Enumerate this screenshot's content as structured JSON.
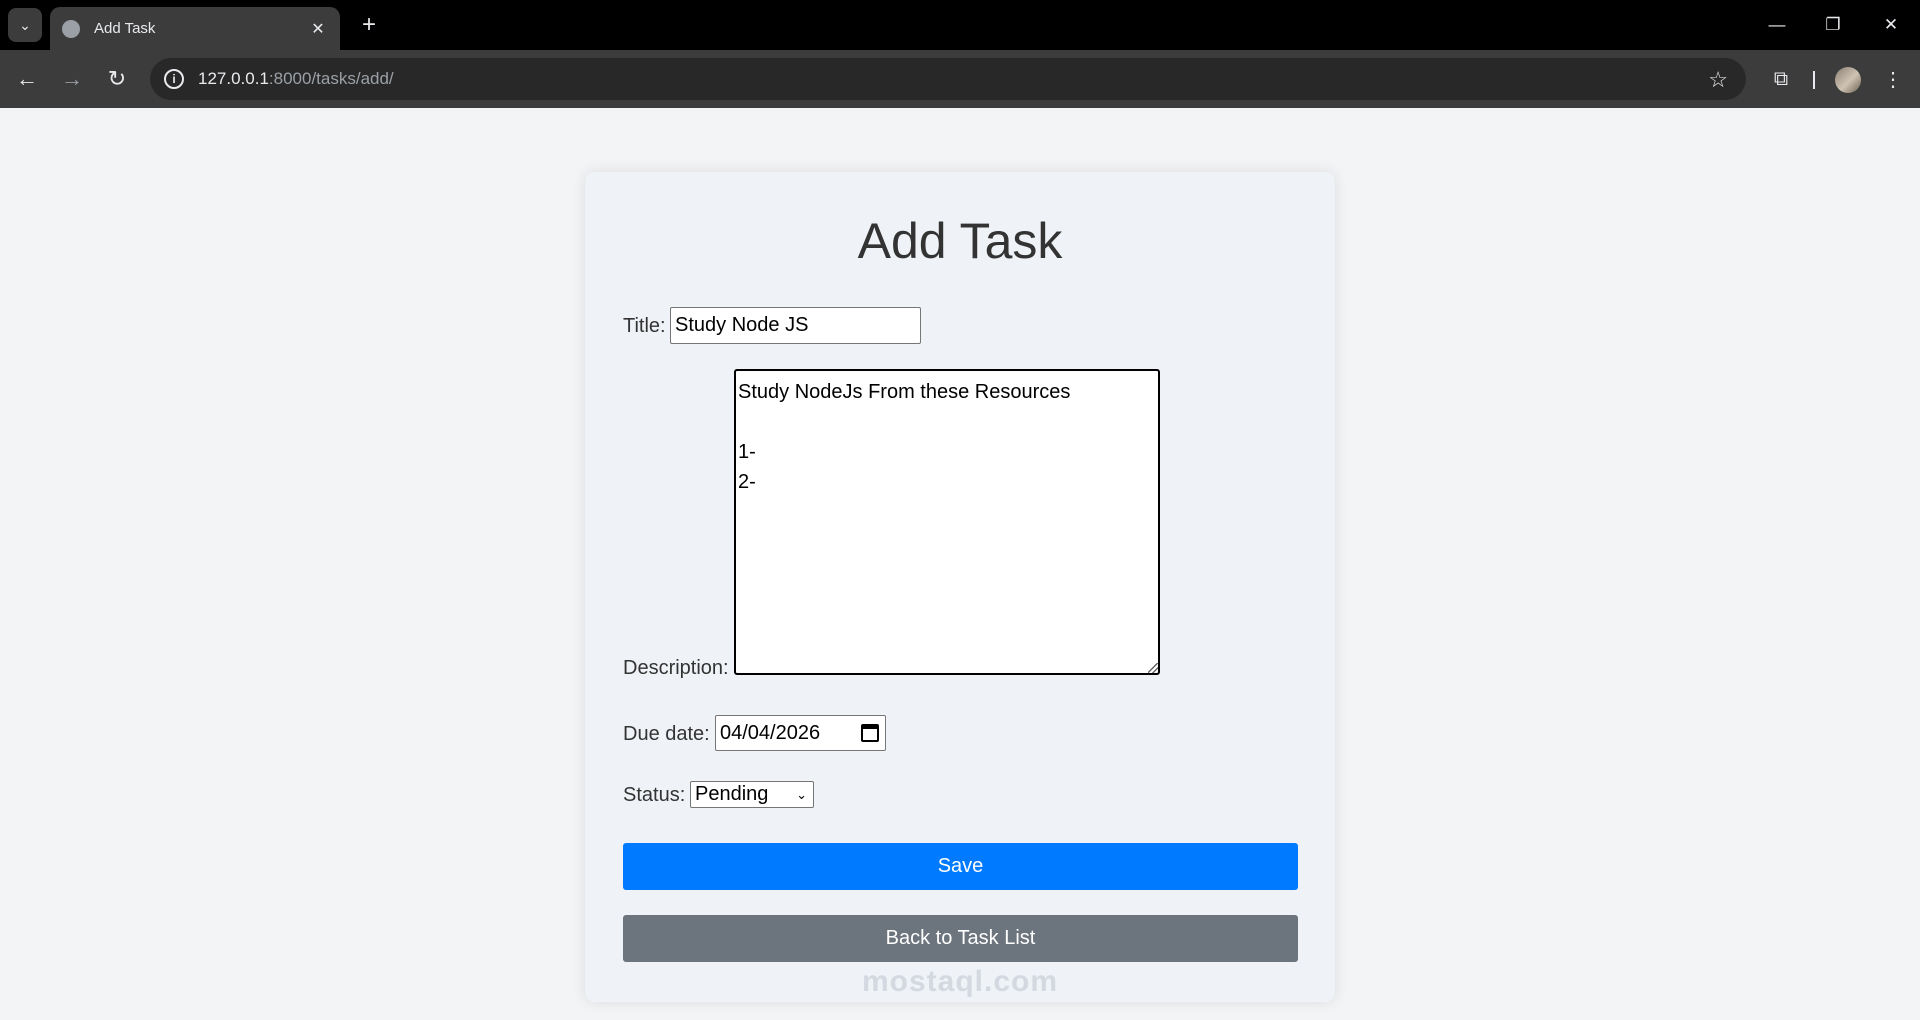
{
  "browser": {
    "tab_title": "Add Task",
    "tab_close": "✕",
    "new_tab": "+",
    "url_host": "127.0.0.1",
    "url_rest": ":8000/tasks/add/",
    "icons": [
      "tab-list-icon",
      "globe-icon",
      "close-icon",
      "plus-icon",
      "minimize-icon",
      "restore-icon",
      "close-window-icon",
      "back-icon",
      "forward-icon",
      "reload-icon",
      "info-icon",
      "star-icon",
      "extensions-icon",
      "avatar",
      "more-icon"
    ]
  },
  "form": {
    "heading": "Add Task",
    "title_label": "Title:",
    "title_value": "Study Node JS",
    "description_label": "Description:",
    "description_value": "Study NodeJs From these Resources\n\n1-\n2-",
    "due_date_label": "Due date:",
    "due_date_value": "04/04/2026",
    "status_label": "Status:",
    "status_value": "Pending",
    "save_label": "Save",
    "back_label": "Back to Task List"
  },
  "watermark": "mostaql.com",
  "colors": {
    "save_button": "#007bff",
    "back_button": "#6c757d"
  }
}
